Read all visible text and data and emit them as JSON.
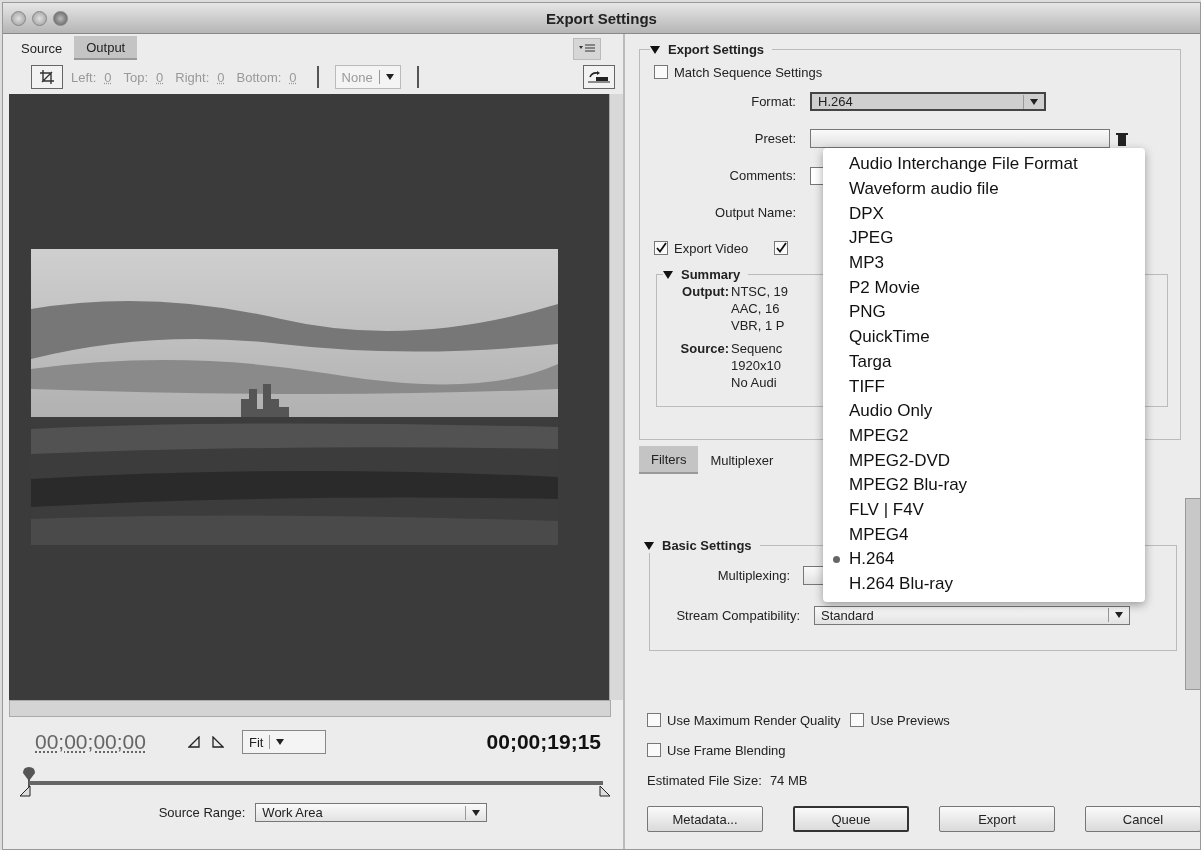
{
  "window": {
    "title": "Export Settings"
  },
  "source_panel": {
    "tabs": [
      {
        "label": "Source",
        "selected": true
      },
      {
        "label": "Output",
        "selected": false
      }
    ],
    "crop_fields": [
      {
        "label": "Left:",
        "value": "0"
      },
      {
        "label": "Top:",
        "value": "0"
      },
      {
        "label": "Right:",
        "value": "0"
      },
      {
        "label": "Bottom:",
        "value": "0"
      }
    ],
    "crop_ratio": "None",
    "current_time": "00;00;00;00",
    "playhead": {
      "level": 0
    },
    "zoom": "Fit",
    "duration": "00;00;19;15",
    "source_range": {
      "label": "Source Range:",
      "value": "Work Area"
    }
  },
  "export_settings": {
    "title": "Export Settings",
    "expanded": true,
    "match_sequence": {
      "label": "Match Sequence Settings",
      "checked": false
    },
    "format": {
      "label": "Format:",
      "value": "H.264"
    },
    "preset": {
      "label": "Preset:"
    },
    "comments": {
      "label": "Comments:"
    },
    "output_name": {
      "label": "Output Name:"
    },
    "export_video": {
      "label": "Export Video",
      "checked": true
    },
    "export_audio": {
      "checked": true
    },
    "summary": {
      "title": "Summary",
      "expanded": true,
      "entries": [
        {
          "label": "Output:",
          "lines": [
            "NTSC, 19",
            "AAC, 16",
            "VBR, 1 P"
          ]
        },
        {
          "label": "Source:",
          "lines": [
            "Sequenc",
            "1920x10",
            "No Audi"
          ]
        }
      ]
    }
  },
  "format_menu": [
    {
      "label": "Audio Interchange File Format",
      "selected": false
    },
    {
      "label": "Waveform audio file",
      "selected": false
    },
    {
      "label": "DPX",
      "selected": false
    },
    {
      "label": "JPEG",
      "selected": false
    },
    {
      "label": "MP3",
      "selected": false
    },
    {
      "label": "P2 Movie",
      "selected": false
    },
    {
      "label": "PNG",
      "selected": false
    },
    {
      "label": "QuickTime",
      "selected": false
    },
    {
      "label": "Targa",
      "selected": false
    },
    {
      "label": "TIFF",
      "selected": false
    },
    {
      "label": "Audio Only",
      "selected": false
    },
    {
      "label": "MPEG2",
      "selected": false
    },
    {
      "label": "MPEG2-DVD",
      "selected": false
    },
    {
      "label": "MPEG2 Blu-ray",
      "selected": false
    },
    {
      "label": "FLV | F4V",
      "selected": false
    },
    {
      "label": "MPEG4",
      "selected": false
    },
    {
      "label": "H.264",
      "selected": true
    },
    {
      "label": "H.264 Blu-ray",
      "selected": false
    }
  ],
  "settings_tabs": [
    {
      "label": "Filters",
      "selected": false
    },
    {
      "label": "Multiplexer",
      "selected": true
    }
  ],
  "basic_settings": {
    "title": "Basic Settings",
    "expanded": true,
    "multiplexing": {
      "label": "Multiplexing:"
    },
    "stream_compatibility": {
      "label": "Stream Compatibility:",
      "value": "Standard"
    }
  },
  "options": [
    {
      "label": "Use Maximum Render Quality",
      "checked": false
    },
    {
      "label": "Use Previews",
      "checked": false
    },
    {
      "label": "Use Frame Blending",
      "checked": false
    }
  ],
  "estimated_size": {
    "label": "Estimated File Size:",
    "value": "74 MB"
  },
  "buttons": [
    {
      "label": "Metadata...",
      "default": false
    },
    {
      "label": "Queue",
      "default": true
    },
    {
      "label": "Export",
      "default": false
    },
    {
      "label": "Cancel",
      "default": false
    }
  ]
}
